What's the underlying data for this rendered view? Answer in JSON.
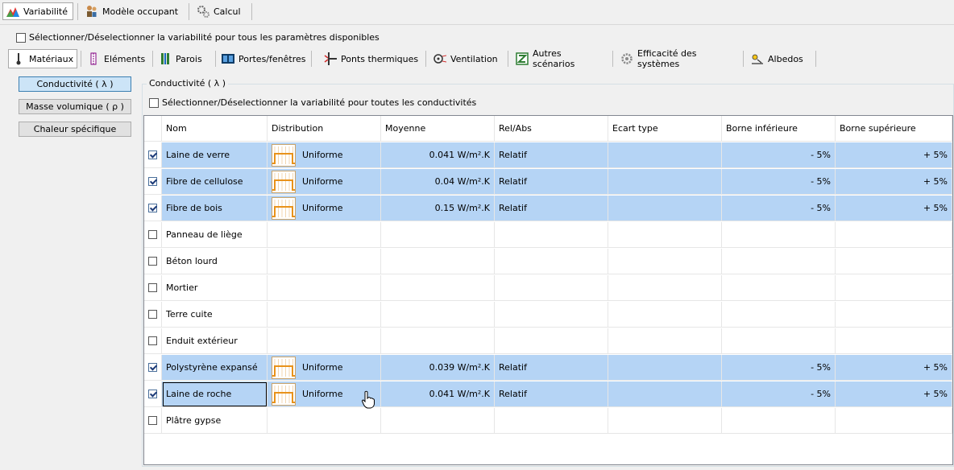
{
  "top_tabs": [
    {
      "label": "Variabilité",
      "icon": "mountain-chart-icon",
      "selected": true
    },
    {
      "label": "Modèle occupant",
      "icon": "people-icon",
      "selected": false
    },
    {
      "label": "Calcul",
      "icon": "gears-icon",
      "selected": false
    }
  ],
  "select_all_params_label": "Sélectionner/Déselectionner la variabilité pour tous les paramètres disponibles",
  "toolbar": [
    {
      "label": "Matériaux",
      "icon": "thermometer-icon",
      "selected": true
    },
    {
      "label": "Eléments",
      "icon": "layers-icon",
      "selected": false
    },
    {
      "label": "Parois",
      "icon": "wall-icon",
      "selected": false
    },
    {
      "label": "Portes/fenêtres",
      "icon": "window-icon",
      "selected": false
    },
    {
      "label": "Ponts thermiques",
      "icon": "thermal-bridge-icon",
      "selected": false
    },
    {
      "label": "Ventilation",
      "icon": "fan-icon",
      "selected": false
    },
    {
      "label": "Autres scénarios",
      "icon": "z-icon",
      "selected": false
    },
    {
      "label": "Efficacité des systèmes",
      "icon": "gear-icon",
      "selected": false
    },
    {
      "label": "Albedos",
      "icon": "albedo-icon",
      "selected": false
    }
  ],
  "left_buttons": [
    {
      "label": "Conductivité ( λ )",
      "selected": true
    },
    {
      "label": "Masse volumique ( ρ )",
      "selected": false
    },
    {
      "label": "Chaleur spécifique",
      "selected": false
    }
  ],
  "group_title": "Conductivité ( λ )",
  "select_all_cond_label": "Sélectionner/Déselectionner la variabilité pour toutes les conductivités",
  "columns": [
    "Nom",
    "Distribution",
    "Moyenne",
    "Rel/Abs",
    "Ecart type",
    "Borne inférieure",
    "Borne supérieure"
  ],
  "rows": [
    {
      "checked": true,
      "name": "Laine de verre",
      "distribution": "Uniforme",
      "mean": "0.041 W/m².K",
      "relabs": "Relatif",
      "std": "",
      "low": "- 5%",
      "high": "+ 5%"
    },
    {
      "checked": true,
      "name": "Fibre de cellulose",
      "distribution": "Uniforme",
      "mean": "0.04 W/m².K",
      "relabs": "Relatif",
      "std": "",
      "low": "- 5%",
      "high": "+ 5%"
    },
    {
      "checked": true,
      "name": "Fibre de bois",
      "distribution": "Uniforme",
      "mean": "0.15 W/m².K",
      "relabs": "Relatif",
      "std": "",
      "low": "- 5%",
      "high": "+ 5%"
    },
    {
      "checked": false,
      "name": "Panneau de liège",
      "distribution": "",
      "mean": "",
      "relabs": "",
      "std": "",
      "low": "",
      "high": ""
    },
    {
      "checked": false,
      "name": "Béton lourd",
      "distribution": "",
      "mean": "",
      "relabs": "",
      "std": "",
      "low": "",
      "high": ""
    },
    {
      "checked": false,
      "name": "Mortier",
      "distribution": "",
      "mean": "",
      "relabs": "",
      "std": "",
      "low": "",
      "high": ""
    },
    {
      "checked": false,
      "name": "Terre cuite",
      "distribution": "",
      "mean": "",
      "relabs": "",
      "std": "",
      "low": "",
      "high": ""
    },
    {
      "checked": false,
      "name": "Enduit extérieur",
      "distribution": "",
      "mean": "",
      "relabs": "",
      "std": "",
      "low": "",
      "high": ""
    },
    {
      "checked": true,
      "name": "Polystyrène expansé",
      "distribution": "Uniforme",
      "mean": "0.039 W/m².K",
      "relabs": "Relatif",
      "std": "",
      "low": "- 5%",
      "high": "+ 5%"
    },
    {
      "checked": true,
      "name": "Laine de roche",
      "distribution": "Uniforme",
      "mean": "0.041 W/m².K",
      "relabs": "Relatif",
      "std": "",
      "low": "- 5%",
      "high": "+ 5%"
    },
    {
      "checked": false,
      "name": "Plâtre gypse",
      "distribution": "",
      "mean": "",
      "relabs": "",
      "std": "",
      "low": "",
      "high": ""
    }
  ],
  "colors": {
    "selected_row": "#b5d4f5",
    "selected_button": "#cce4f7",
    "dist_icon": "#e8921a"
  }
}
